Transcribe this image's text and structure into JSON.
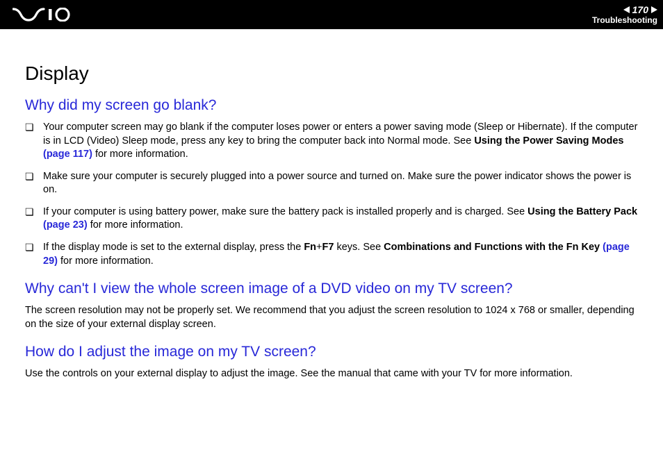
{
  "header": {
    "page_number": "170",
    "section": "Troubleshooting"
  },
  "content": {
    "title": "Display",
    "q1": {
      "heading": "Why did my screen go blank?",
      "items": [
        {
          "pre": "Your computer screen may go blank if the computer loses power or enters a power saving mode (Sleep or Hibernate). If the computer is in LCD (Video) Sleep mode, press any key to bring the computer back into Normal mode. See ",
          "bold": "Using the Power Saving Modes ",
          "link": "(page 117)",
          "post": " for more information."
        },
        {
          "text": "Make sure your computer is securely plugged into a power source and turned on. Make sure the power indicator shows the power is on."
        },
        {
          "pre": "If your computer is using battery power, make sure the battery pack is installed properly and is charged. See ",
          "bold": "Using the Battery Pack ",
          "link": "(page 23)",
          "post": " for more information."
        },
        {
          "pre": "If the display mode is set to the external display, press the ",
          "bold1": "Fn",
          "mid": "+",
          "bold2": "F7",
          "mid2": " keys. See ",
          "bold3": "Combinations and Functions with the Fn Key ",
          "link": "(page 29)",
          "post": " for more information."
        }
      ]
    },
    "q2": {
      "heading": "Why can't I view the whole screen image of a DVD video on my TV screen?",
      "para": "The screen resolution may not be properly set. We recommend that you adjust the screen resolution to 1024 x 768 or smaller, depending on the size of your external display screen."
    },
    "q3": {
      "heading": "How do I adjust the image on my TV screen?",
      "para": "Use the controls on your external display to adjust the image. See the manual that came with your TV for more information."
    }
  }
}
